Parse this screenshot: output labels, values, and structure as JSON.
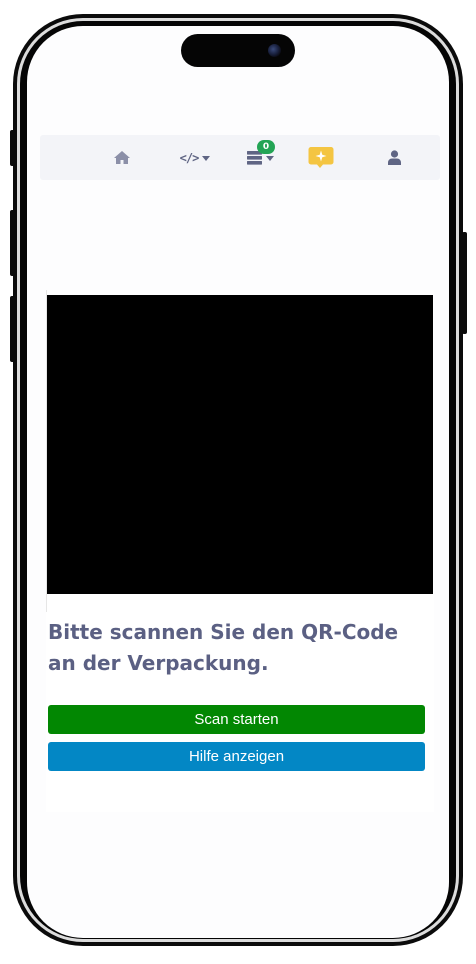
{
  "navbar": {
    "items": [
      {
        "icon": "home-icon"
      },
      {
        "icon": "code-icon",
        "glyph": "</>",
        "has_dropdown": true
      },
      {
        "icon": "database-icon",
        "badge": "0",
        "has_dropdown": true
      },
      {
        "icon": "chat-sparkle-icon"
      },
      {
        "icon": "user-icon"
      }
    ],
    "badge_color": "#23a455",
    "accent_color": "#f4c542",
    "icon_color": "#5f6584"
  },
  "scanner": {
    "prompt": "Bitte scannen Sie den QR-Code an der Verpackung.",
    "scan_button_label": "Scan starten",
    "help_button_label": "Hilfe anzeigen",
    "scan_button_color": "#028702",
    "help_button_color": "#0387c5"
  }
}
